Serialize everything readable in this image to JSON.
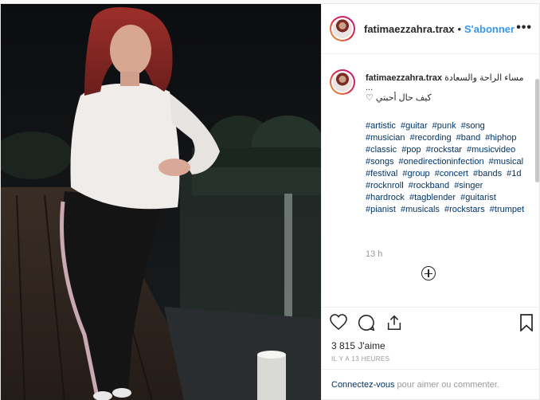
{
  "header": {
    "username": "fatimaezzahra.trax",
    "separator": "•",
    "follow_label": "S'abonner",
    "more_label": "•••"
  },
  "caption": {
    "username": "fatimaezzahra.trax",
    "line1": "مساء الراحة والسعادة",
    "ellipsis": "...",
    "line2": "♡ كيف حال أحبتي",
    "hashtags": [
      "#artistic",
      "#guitar",
      "#punk",
      "#song",
      "#musician",
      "#recording",
      "#band",
      "#hiphop",
      "#classic",
      "#pop",
      "#rockstar",
      "#musicvideo",
      "#songs",
      "#onedirectioninfection",
      "#musical",
      "#festival",
      "#group",
      "#concert",
      "#bands",
      "#1d",
      "#rocknroll",
      "#rockband",
      "#singer",
      "#hardrock",
      "#tagblender",
      "#guitarist",
      "#pianist",
      "#musicals",
      "#rockstars",
      "#trumpet"
    ],
    "time": "13 h"
  },
  "actions": {
    "icons": [
      "heart-icon",
      "comment-icon",
      "share-icon",
      "bookmark-icon"
    ],
    "likes": "3 815 J'aime",
    "date": "IL Y A 13 HEURES"
  },
  "footer": {
    "login_link": "Connectez-vous",
    "login_rest": " pour aimer ou commenter."
  },
  "colors": {
    "link": "#3897f0",
    "hashtag": "#003569",
    "muted": "#999999",
    "border": "#efefef"
  }
}
